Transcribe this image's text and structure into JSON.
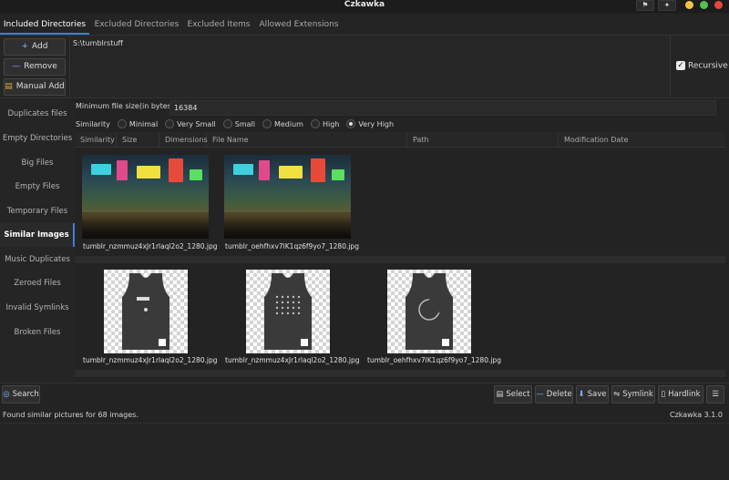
{
  "window": {
    "title": "Czkawka"
  },
  "tabs": [
    {
      "label": "Included Directories"
    },
    {
      "label": "Excluded Directories"
    },
    {
      "label": "Excluded Items"
    },
    {
      "label": "Allowed Extensions"
    }
  ],
  "dirs": {
    "add_label": "Add",
    "remove_label": "Remove",
    "manual_add_label": "Manual Add",
    "included_path": "S:\\tumblrstuff",
    "recursive_label": "Recursive",
    "recursive_checked": true
  },
  "sidebar": {
    "items": [
      {
        "label": "Duplicates files"
      },
      {
        "label": "Empty Directories"
      },
      {
        "label": "Big Files"
      },
      {
        "label": "Empty Files"
      },
      {
        "label": "Temporary Files"
      },
      {
        "label": "Similar Images"
      },
      {
        "label": "Music Duplicates"
      },
      {
        "label": "Zeroed Files"
      },
      {
        "label": "Invalid Symlinks"
      },
      {
        "label": "Broken Files"
      }
    ],
    "active": "Similar Images"
  },
  "main": {
    "min_size_label": "Minimum file size(in bytes)",
    "min_size_value": "16384",
    "similarity_label": "Similarity",
    "similarity_options": [
      "Minimal",
      "Very Small",
      "Small",
      "Medium",
      "High",
      "Very High"
    ],
    "similarity_selected": "Very High",
    "columns": [
      "Similarity",
      "Size",
      "Dimensions",
      "File Name",
      "Path",
      "Modification Date"
    ],
    "groups": [
      {
        "files": [
          {
            "name": "tumblr_nzmmuz4xJr1rlaql2o2_1280.jpg",
            "image": "neon-street-photo"
          },
          {
            "name": "tumblr_oehfhxv7lK1qz6f9yo7_1280.jpg",
            "image": "neon-street-photo"
          }
        ]
      },
      {
        "files": [
          {
            "name": "tumblr_nzmmuz4xJr1rlaql2o2_1280.jpg",
            "image": "black-tank-top-dots"
          },
          {
            "name": "tumblr_nzmmuz4xJr1rlaql2o2_1280.jpg",
            "image": "black-tank-top-grid"
          },
          {
            "name": "tumblr_oehfhxv7lK1qz6f9yo7_1280.jpg",
            "image": "black-tank-top-moon"
          }
        ]
      }
    ]
  },
  "toolbar": {
    "search_label": "Search",
    "select_label": "Select",
    "delete_label": "Delete",
    "save_label": "Save",
    "symlink_label": "Symlink",
    "hardlink_label": "Hardlink"
  },
  "status": {
    "message": "Found similar pictures for 68 images.",
    "version": "Czkawka 3.1.0"
  },
  "colors": {
    "accent": "#3d7fcf",
    "background": "#232323"
  }
}
